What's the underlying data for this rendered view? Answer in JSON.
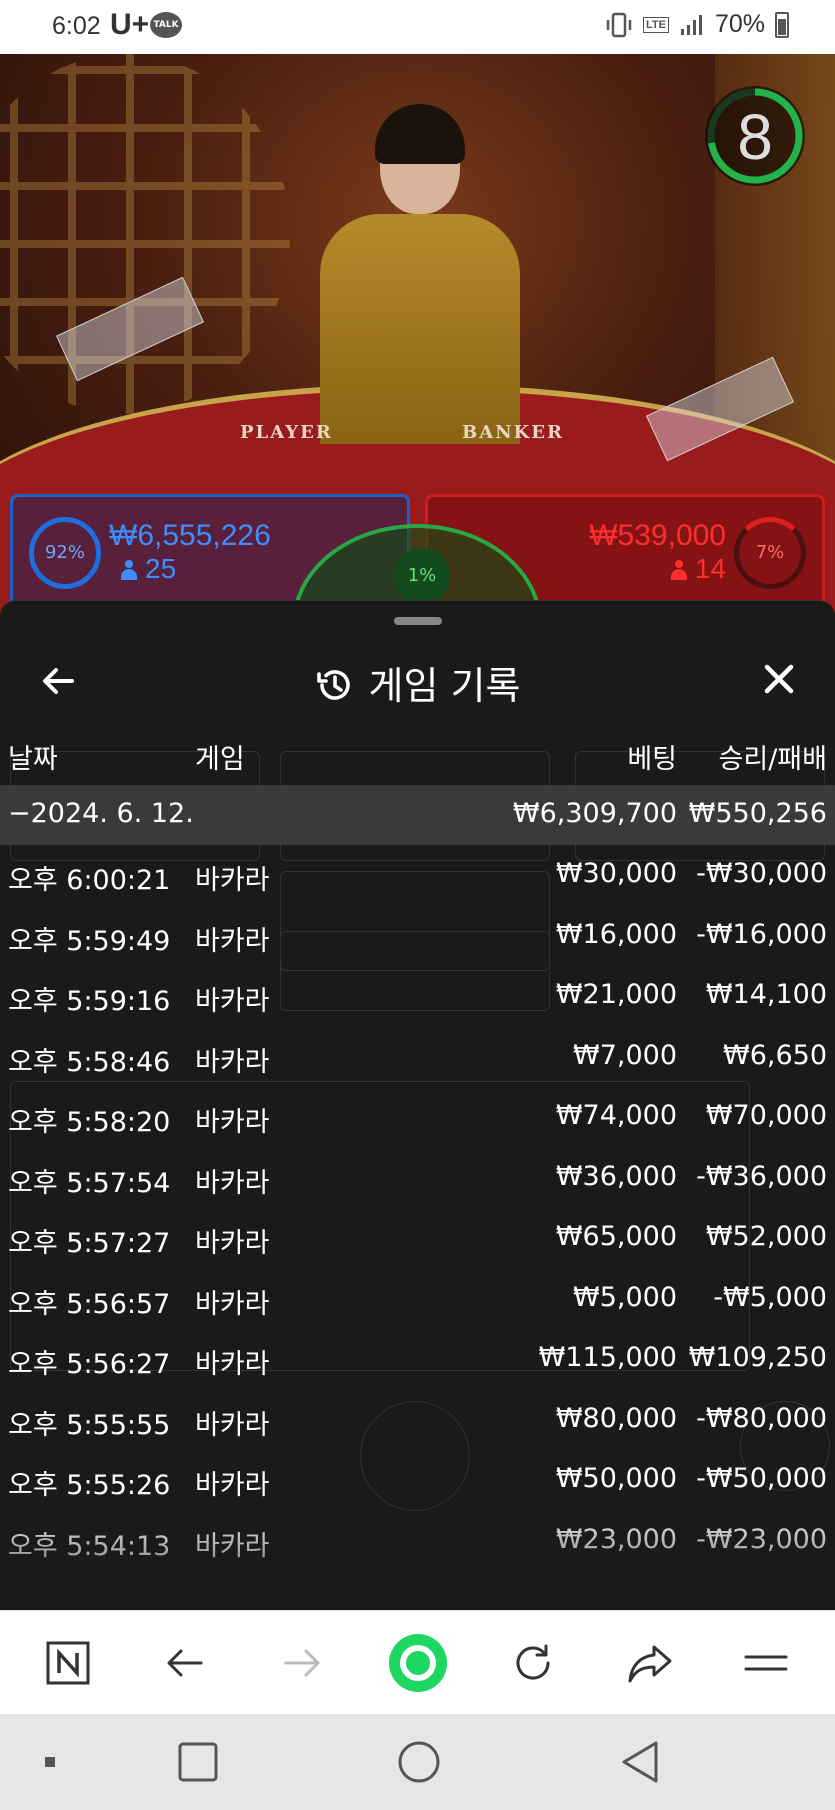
{
  "status_bar": {
    "time": "6:02",
    "carrier": "U+",
    "talk_badge": "TALK",
    "network": "LTE",
    "battery": "70%"
  },
  "live_game": {
    "timer": "8",
    "table_labels": {
      "player": "PLAYER",
      "banker": "BANKER"
    },
    "player_side": {
      "percent": "92%",
      "amount": "₩6,555,226",
      "players": "25",
      "color": "#1d6fe0"
    },
    "tie_side": {
      "percent": "1%",
      "color": "#28a745"
    },
    "banker_side": {
      "percent": "7%",
      "amount": "₩539,000",
      "players": "14",
      "color": "#e02020"
    }
  },
  "sheet": {
    "title": "게임 기록",
    "columns": {
      "date": "날짜",
      "game": "게임",
      "bet": "베팅",
      "result": "승리/패배"
    },
    "summary": {
      "date": "−2024. 6. 12.",
      "bet": "₩6,309,700",
      "result": "₩550,256"
    },
    "rows": [
      {
        "time": "오후 6:00:21",
        "game": "바카라",
        "bet": "₩30,000",
        "result": "-₩30,000"
      },
      {
        "time": "오후 5:59:49",
        "game": "바카라",
        "bet": "₩16,000",
        "result": "-₩16,000"
      },
      {
        "time": "오후 5:59:16",
        "game": "바카라",
        "bet": "₩21,000",
        "result": "₩14,100"
      },
      {
        "time": "오후 5:58:46",
        "game": "바카라",
        "bet": "₩7,000",
        "result": "₩6,650"
      },
      {
        "time": "오후 5:58:20",
        "game": "바카라",
        "bet": "₩74,000",
        "result": "₩70,000"
      },
      {
        "time": "오후 5:57:54",
        "game": "바카라",
        "bet": "₩36,000",
        "result": "-₩36,000"
      },
      {
        "time": "오후 5:57:27",
        "game": "바카라",
        "bet": "₩65,000",
        "result": "₩52,000"
      },
      {
        "time": "오후 5:56:57",
        "game": "바카라",
        "bet": "₩5,000",
        "result": "-₩5,000"
      },
      {
        "time": "오후 5:56:27",
        "game": "바카라",
        "bet": "₩115,000",
        "result": "₩109,250"
      },
      {
        "time": "오후 5:55:55",
        "game": "바카라",
        "bet": "₩80,000",
        "result": "-₩80,000"
      },
      {
        "time": "오후 5:55:26",
        "game": "바카라",
        "bet": "₩50,000",
        "result": "-₩50,000"
      },
      {
        "time": "오후 5:54:13",
        "game": "바카라",
        "bet": "₩23,000",
        "result": "-₩23,000"
      }
    ]
  },
  "browser_bar": {
    "icons": [
      "naver-icon",
      "back-arrow-icon",
      "forward-arrow-icon",
      "home-circle-icon",
      "reload-icon",
      "share-icon",
      "menu-icon"
    ],
    "accent": "#1ed760"
  },
  "nav_bar": {
    "icons": [
      "dot-icon",
      "recents-icon",
      "home-icon",
      "back-icon"
    ]
  }
}
